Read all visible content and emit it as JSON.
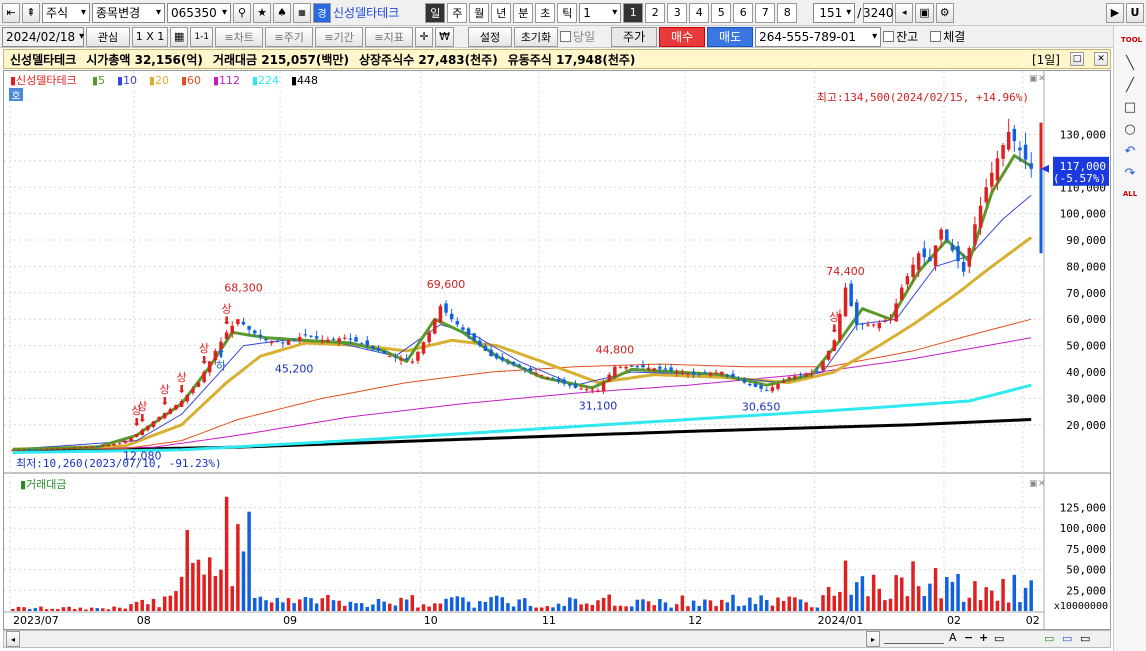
{
  "toolbar1": {
    "market": "주식",
    "change_item": "종목변경",
    "code": "065350",
    "name_icon": "경",
    "name": "신성델타테크",
    "periods": [
      "일",
      "주",
      "월",
      "년",
      "분",
      "초",
      "틱"
    ],
    "period_num": "1",
    "nums": [
      "1",
      "2",
      "3",
      "4",
      "5",
      "6",
      "7",
      "8"
    ],
    "count": "151",
    "slash": "/",
    "total": "3240",
    "right_btn": "U"
  },
  "toolbar2": {
    "date": "2024/02/18",
    "interest": "관심",
    "layout": "1 X 1",
    "page": "1-1",
    "chart_type": "≡차트",
    "cycle": "≡주기",
    "period": "≡기간",
    "indicator": "≡지표",
    "won": "₩",
    "settings": "설정",
    "reset": "초기화",
    "same_day": "당일",
    "price": "주가",
    "buy": "매수",
    "sell": "매도",
    "account": "264-555-789-01",
    "balance": "잔고",
    "executed": "체결"
  },
  "infobar": {
    "name": "신성델타테크",
    "market_cap": "시가총액 32,156(억)",
    "trade_amount": "거래대금 215,057(백만)",
    "listed": "상장주식수 27,483(천주)",
    "float": "유동주식 17,948(천주)",
    "period_label": "[1일]"
  },
  "legend": {
    "name": "신성델타테크",
    "mas": [
      {
        "label": "5",
        "color": "#5a9a2a"
      },
      {
        "label": "10",
        "color": "#3a46d8"
      },
      {
        "label": "20",
        "color": "#d8b030"
      },
      {
        "label": "60",
        "color": "#e05020"
      },
      {
        "label": "112",
        "color": "#c020c0"
      },
      {
        "label": "224",
        "color": "#30e8f0"
      },
      {
        "label": "448",
        "color": "#000000"
      }
    ],
    "ho": "호"
  },
  "volume_title": "거래대금",
  "colors": {
    "up": "#e02020",
    "down": "#1060e0",
    "current": "#1a3adf"
  },
  "chart_data": {
    "type": "candlestick",
    "price_ticks": [
      20000,
      30000,
      40000,
      50000,
      60000,
      70000,
      80000,
      90000,
      100000,
      110000,
      120000,
      130000
    ],
    "price_tick_labels": [
      "20,000",
      "30,000",
      "40,000",
      "50,000",
      "60,000",
      "70,000",
      "80,000",
      "90,000",
      "100,000",
      "110,000",
      "120,000",
      "130,000"
    ],
    "ylim": [
      4000,
      148000
    ],
    "volume_ticks": [
      25000,
      50000,
      75000,
      100000,
      125000
    ],
    "volume_tick_labels": [
      "25,000",
      "50,000",
      "75,000",
      "100,000",
      "125,000"
    ],
    "volume_unit": "x10000000",
    "vol_ylim": [
      0,
      145000
    ],
    "x_labels": [
      {
        "label": "2023/07",
        "i": 0
      },
      {
        "label": "08",
        "i": 22
      },
      {
        "label": "09",
        "i": 48
      },
      {
        "label": "10",
        "i": 73
      },
      {
        "label": "11",
        "i": 94
      },
      {
        "label": "12",
        "i": 120
      },
      {
        "label": "2024/01",
        "i": 143
      },
      {
        "label": "02",
        "i": 166
      },
      {
        "label": "02",
        "i": 180
      }
    ],
    "current_price": {
      "label": "117,000",
      "change": "(-5.57%)",
      "value": 117000
    },
    "annotations": {
      "high": "최고:134,500(2024/02/15, +14.96%)",
      "low": "최저:10,260(2023/07/10, -91.23%)",
      "peaks": [
        {
          "text": "68,300",
          "i": 41,
          "value": 68300,
          "pos": "above",
          "color": "#d02020"
        },
        {
          "text": "69,600",
          "i": 77,
          "value": 69600,
          "pos": "above",
          "color": "#d02020"
        },
        {
          "text": "74,400",
          "i": 148,
          "value": 74400,
          "pos": "above",
          "color": "#d02020"
        },
        {
          "text": "44,800",
          "i": 107,
          "value": 44800,
          "pos": "above",
          "color": "#d02020"
        },
        {
          "text": "12,080",
          "i": 23,
          "value": 12080,
          "pos": "below",
          "color": "#1a30c0"
        },
        {
          "text": "45,200",
          "i": 50,
          "value": 45200,
          "pos": "below",
          "color": "#1a30c0"
        },
        {
          "text": "31,100",
          "i": 104,
          "value": 31100,
          "pos": "below",
          "color": "#1a30c0"
        },
        {
          "text": "30,650",
          "i": 133,
          "value": 30650,
          "pos": "below",
          "color": "#1a30c0"
        }
      ],
      "sang": [
        {
          "text": "상",
          "i": 22
        },
        {
          "text": "상",
          "i": 23
        },
        {
          "text": "상",
          "i": 27
        },
        {
          "text": "상",
          "i": 30
        },
        {
          "text": "상",
          "i": 34
        },
        {
          "text": "상",
          "i": 38
        },
        {
          "text": "상",
          "i": 146
        }
      ],
      "ha": [
        {
          "text": "하",
          "i": 37
        }
      ]
    },
    "anchors": [
      [
        0,
        10500
      ],
      [
        8,
        11000
      ],
      [
        15,
        11800
      ],
      [
        19,
        13000
      ],
      [
        21,
        15000
      ],
      [
        23,
        18000
      ],
      [
        26,
        23000
      ],
      [
        30,
        29000
      ],
      [
        33,
        36000
      ],
      [
        36,
        48000
      ],
      [
        38,
        55000
      ],
      [
        40,
        60000
      ],
      [
        42,
        56000
      ],
      [
        45,
        52000
      ],
      [
        48,
        51000
      ],
      [
        52,
        54000
      ],
      [
        55,
        52000
      ],
      [
        59,
        53000
      ],
      [
        63,
        50000
      ],
      [
        67,
        46000
      ],
      [
        71,
        44000
      ],
      [
        74,
        55000
      ],
      [
        76,
        65000
      ],
      [
        78,
        60000
      ],
      [
        81,
        54000
      ],
      [
        85,
        46000
      ],
      [
        90,
        42000
      ],
      [
        95,
        38000
      ],
      [
        100,
        34000
      ],
      [
        104,
        33000
      ],
      [
        107,
        42000
      ],
      [
        111,
        42000
      ],
      [
        116,
        41000
      ],
      [
        121,
        39000
      ],
      [
        126,
        40000
      ],
      [
        131,
        35000
      ],
      [
        134,
        33000
      ],
      [
        138,
        38000
      ],
      [
        143,
        40000
      ],
      [
        146,
        52000
      ],
      [
        148,
        72000
      ],
      [
        150,
        58000
      ],
      [
        153,
        58000
      ],
      [
        156,
        60000
      ],
      [
        158,
        72000
      ],
      [
        161,
        85000
      ],
      [
        163,
        82000
      ],
      [
        165,
        94000
      ],
      [
        167,
        86000
      ],
      [
        169,
        78000
      ],
      [
        171,
        96000
      ],
      [
        173,
        110000
      ],
      [
        175,
        121000
      ],
      [
        177,
        131000
      ],
      [
        179,
        124000
      ],
      [
        181,
        117000
      ]
    ],
    "ma_anchors": {
      "5": [
        [
          0,
          10700
        ],
        [
          15,
          11500
        ],
        [
          22,
          16000
        ],
        [
          30,
          28000
        ],
        [
          35,
          42000
        ],
        [
          39,
          55000
        ],
        [
          45,
          53000
        ],
        [
          52,
          52000
        ],
        [
          60,
          51000
        ],
        [
          66,
          48000
        ],
        [
          70,
          44000
        ],
        [
          75,
          60000
        ],
        [
          80,
          55000
        ],
        [
          86,
          46000
        ],
        [
          94,
          38000
        ],
        [
          103,
          34000
        ],
        [
          110,
          41000
        ],
        [
          118,
          40000
        ],
        [
          126,
          39000
        ],
        [
          134,
          35000
        ],
        [
          142,
          39000
        ],
        [
          147,
          52000
        ],
        [
          151,
          64000
        ],
        [
          156,
          60000
        ],
        [
          161,
          78000
        ],
        [
          166,
          90000
        ],
        [
          170,
          82000
        ],
        [
          174,
          108000
        ],
        [
          178,
          122000
        ],
        [
          181,
          118000
        ]
      ],
      "10": [
        [
          0,
          10700
        ],
        [
          22,
          14000
        ],
        [
          30,
          24000
        ],
        [
          36,
          38000
        ],
        [
          41,
          50000
        ],
        [
          48,
          52000
        ],
        [
          58,
          51000
        ],
        [
          68,
          46000
        ],
        [
          76,
          58000
        ],
        [
          82,
          54000
        ],
        [
          90,
          44000
        ],
        [
          100,
          35000
        ],
        [
          110,
          40000
        ],
        [
          124,
          39000
        ],
        [
          136,
          36000
        ],
        [
          144,
          40000
        ],
        [
          150,
          58000
        ],
        [
          157,
          60000
        ],
        [
          164,
          80000
        ],
        [
          170,
          84000
        ],
        [
          176,
          98000
        ],
        [
          181,
          107000
        ]
      ],
      "20": [
        [
          0,
          10700
        ],
        [
          20,
          12000
        ],
        [
          30,
          20000
        ],
        [
          38,
          36000
        ],
        [
          44,
          46000
        ],
        [
          52,
          51000
        ],
        [
          62,
          50000
        ],
        [
          70,
          48000
        ],
        [
          78,
          52000
        ],
        [
          86,
          50000
        ],
        [
          94,
          44000
        ],
        [
          104,
          36000
        ],
        [
          114,
          39000
        ],
        [
          126,
          38000
        ],
        [
          138,
          36000
        ],
        [
          146,
          40000
        ],
        [
          154,
          50000
        ],
        [
          160,
          58000
        ],
        [
          168,
          70000
        ],
        [
          174,
          80000
        ],
        [
          181,
          91000
        ]
      ],
      "60": [
        [
          0,
          10700
        ],
        [
          20,
          11000
        ],
        [
          30,
          14000
        ],
        [
          40,
          22000
        ],
        [
          55,
          30000
        ],
        [
          70,
          36000
        ],
        [
          85,
          40000
        ],
        [
          100,
          42000
        ],
        [
          115,
          43000
        ],
        [
          130,
          42000
        ],
        [
          145,
          42000
        ],
        [
          160,
          48000
        ],
        [
          172,
          55000
        ],
        [
          181,
          60000
        ]
      ],
      "112": [
        [
          0,
          10500
        ],
        [
          25,
          11500
        ],
        [
          40,
          16000
        ],
        [
          60,
          23000
        ],
        [
          80,
          28000
        ],
        [
          100,
          32000
        ],
        [
          120,
          35000
        ],
        [
          140,
          39000
        ],
        [
          160,
          45000
        ],
        [
          181,
          53000
        ]
      ],
      "224": [
        [
          0,
          9500
        ],
        [
          30,
          10500
        ],
        [
          60,
          14000
        ],
        [
          90,
          18000
        ],
        [
          120,
          22000
        ],
        [
          150,
          26000
        ],
        [
          170,
          29000
        ],
        [
          181,
          35000
        ]
      ],
      "448": [
        [
          0,
          10000
        ],
        [
          40,
          11500
        ],
        [
          80,
          14500
        ],
        [
          120,
          17500
        ],
        [
          160,
          20000
        ],
        [
          181,
          22000
        ]
      ]
    }
  },
  "scroll": {
    "right_tools": [
      "A",
      "−",
      "+",
      "▭",
      "▭",
      "▭",
      "▭"
    ]
  },
  "tools": [
    "TOOL",
    "╲",
    "╱",
    "□",
    "○",
    "↶",
    "↷",
    "ALL"
  ]
}
